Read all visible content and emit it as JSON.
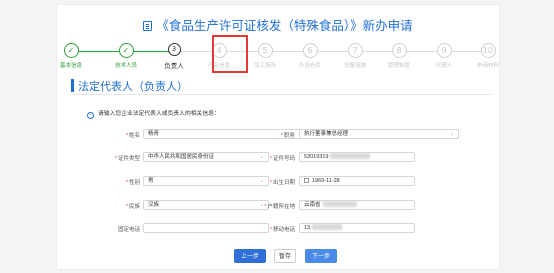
{
  "page": {
    "title": "《食品生产许可证核发（特殊食品）》新办申请"
  },
  "steps": [
    {
      "num": "✓",
      "label": "基本信息",
      "state": "done"
    },
    {
      "num": "✓",
      "label": "技术人员",
      "state": "done"
    },
    {
      "num": "3",
      "label": "负责人",
      "state": "current"
    },
    {
      "num": "4",
      "label": "产品信息",
      "state": "todo"
    },
    {
      "num": "5",
      "label": "加工场所",
      "state": "todo"
    },
    {
      "num": "6",
      "label": "外设仓库",
      "state": "todo"
    },
    {
      "num": "7",
      "label": "设备设施",
      "state": "todo"
    },
    {
      "num": "8",
      "label": "管理制度",
      "state": "todo"
    },
    {
      "num": "9",
      "label": "代理人",
      "state": "todo"
    },
    {
      "num": "10",
      "label": "申请材料",
      "state": "todo"
    }
  ],
  "section": {
    "title": "法定代表人（负责人）"
  },
  "hint": "请输入您企业法定代表人或负责人的相关信息：",
  "form": {
    "name_label": "姓名",
    "name_value": "杨青",
    "position_label": "职务",
    "position_value": "执行董事兼总经理",
    "idtype_label": "证件类型",
    "idtype_value": "中华人民共和国居民身份证",
    "idnum_label": "证件号码",
    "idnum_value": "53019319",
    "gender_label": "性别",
    "gender_value": "男",
    "birth_label": "出生日期",
    "birth_value": "1969-11-28",
    "ethnic_label": "民族",
    "ethnic_value": "汉族",
    "residence_label": "户籍所在地",
    "residence_value": "云南省",
    "fixedphone_label": "固定电话",
    "fixedphone_value": "",
    "mobile_label": "移动电话",
    "mobile_value": "13"
  },
  "buttons": {
    "prev": "上一步",
    "save": "暂存",
    "next": "下一步"
  },
  "colors": {
    "accent": "#1f6fd6",
    "done": "#2f9e3a",
    "highlight_box": "#e53935"
  }
}
